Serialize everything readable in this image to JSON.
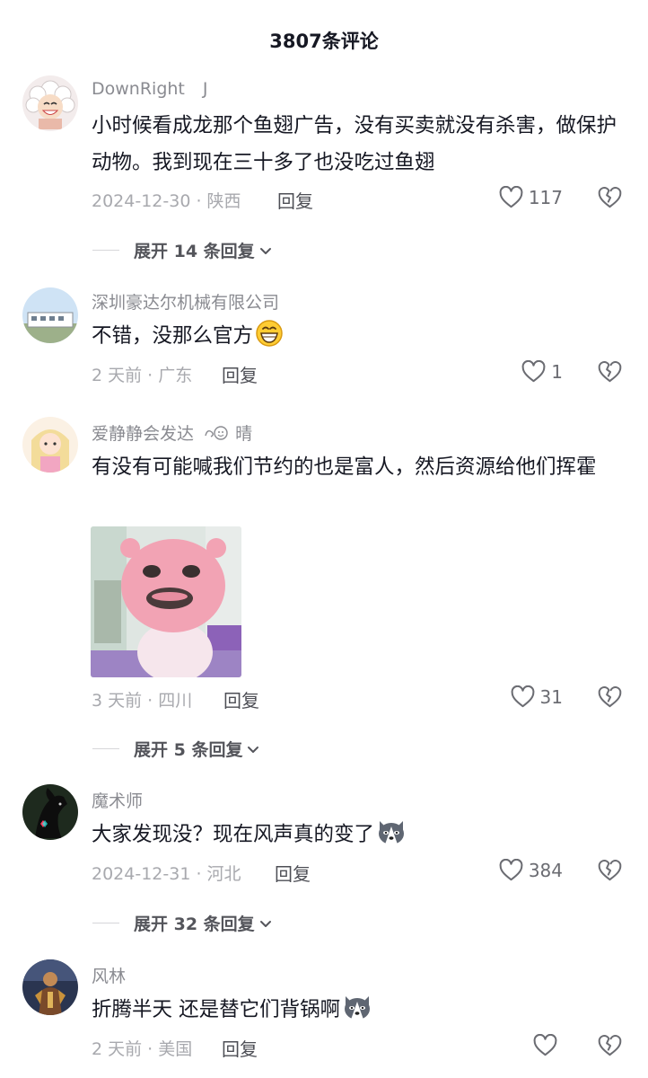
{
  "header": {
    "title": "3807条评论"
  },
  "comments": [
    {
      "username": "DownRight",
      "username_suffix": "J",
      "text": "小时候看成龙那个鱼翅广告，没有买卖就没有杀害，做保护动物。我到现在三十多了也没吃过鱼翅",
      "date_location": "2024-12-30 · 陕西",
      "reply_label": "回复",
      "likes": "117",
      "expand_label": "展开 14 条回复"
    },
    {
      "username": "深圳豪达尔机械有限公司",
      "text": "不错，没那么官方",
      "date_location": "2 天前 · 广东",
      "reply_label": "回复",
      "likes": "1"
    },
    {
      "username": "爱静静会发达",
      "username_suffix": "晴",
      "text": "有没有可能喊我们节约的也是富人，然后资源给他们挥霍",
      "date_location": "3 天前 · 四川",
      "reply_label": "回复",
      "likes": "31",
      "expand_label": "展开 5 条回复"
    },
    {
      "username": "魔术师",
      "text": "大家发现没？现在风声真的变了",
      "date_location": "2024-12-31 · 河北",
      "reply_label": "回复",
      "likes": "384",
      "expand_label": "展开 32 条回复"
    },
    {
      "username": "风林",
      "text": "折腾半天 还是替它们背锅啊",
      "date_location": "2 天前 · 美国",
      "reply_label": "回复",
      "likes": ""
    }
  ],
  "colors": {
    "text": "#161823",
    "secondary": "#8a8b91",
    "meta": "#a8a9ae",
    "reply": "#4d4e55",
    "icon": "#6b6c72"
  },
  "icons": {
    "like": "heart-outline-icon",
    "dislike": "broken-heart-icon",
    "expand": "chevron-down-icon"
  }
}
